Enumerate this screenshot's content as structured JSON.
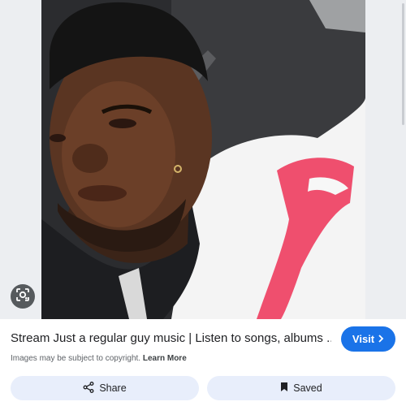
{
  "image": {
    "description_icon": "photo"
  },
  "lens": {
    "icon": "lens-icon"
  },
  "result": {
    "title": "Stream Just a regular guy music | Listen to songs, albums ...",
    "visit_label": "Visit",
    "copyright_text": "Images may be subject to copyright.",
    "learn_more": "Learn More"
  },
  "actions": {
    "share_label": "Share",
    "saved_label": "Saved"
  },
  "colors": {
    "accent": "#1a73e8",
    "button_bg": "#e8eefb"
  }
}
